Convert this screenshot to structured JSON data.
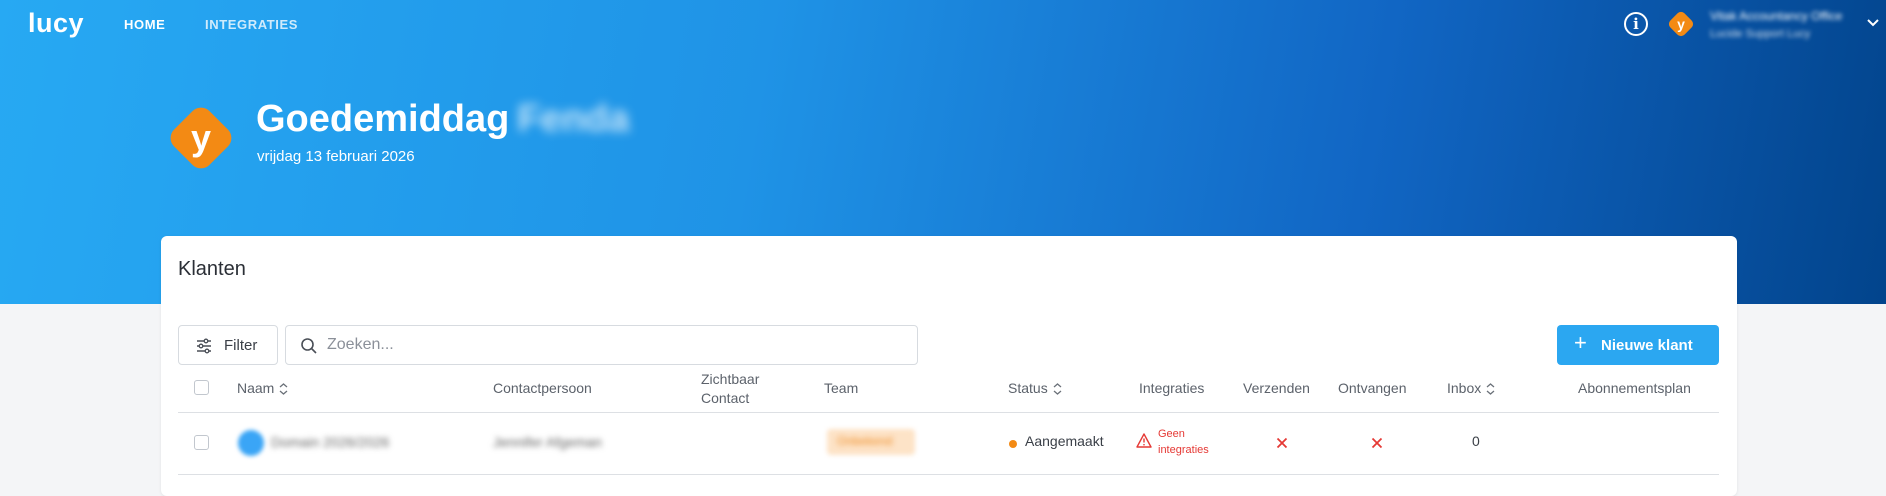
{
  "app": {
    "logo_text": "lucy",
    "nav": {
      "home": "HOME",
      "integrations": "INTEGRATIES"
    }
  },
  "header": {
    "org_name": "Vitak Accountancy Office",
    "org_sub": "Lucide Support Lucy",
    "greeting": "Goedemiddag",
    "user_name": "Fenda",
    "date": "vrijdag 13 februari 2026",
    "avatar_letter": "y"
  },
  "clients": {
    "title": "Klanten",
    "filter_label": "Filter",
    "search_placeholder": "Zoeken...",
    "new_button_label": "Nieuwe klant",
    "columns": {
      "name": "Naam",
      "contact": "Contactpersoon",
      "visible_contact_1": "Zichtbaar",
      "visible_contact_2": "Contact",
      "team": "Team",
      "status": "Status",
      "integrations": "Integraties",
      "send": "Verzenden",
      "receive": "Ontvangen",
      "inbox": "Inbox",
      "subscription": "Abonnementsplan"
    },
    "rows": [
      {
        "name": "Domain 2026/2026",
        "contact": "Jennifer Afgeman",
        "team": "Onbekend",
        "status": "Aangemaakt",
        "integrations_line1": "Geen",
        "integrations_line2": "integraties",
        "inbox": "0"
      }
    ]
  },
  "colors": {
    "accent": "#2ba7f1",
    "avatar_orange": "#f38a14",
    "danger": "#e53935"
  }
}
